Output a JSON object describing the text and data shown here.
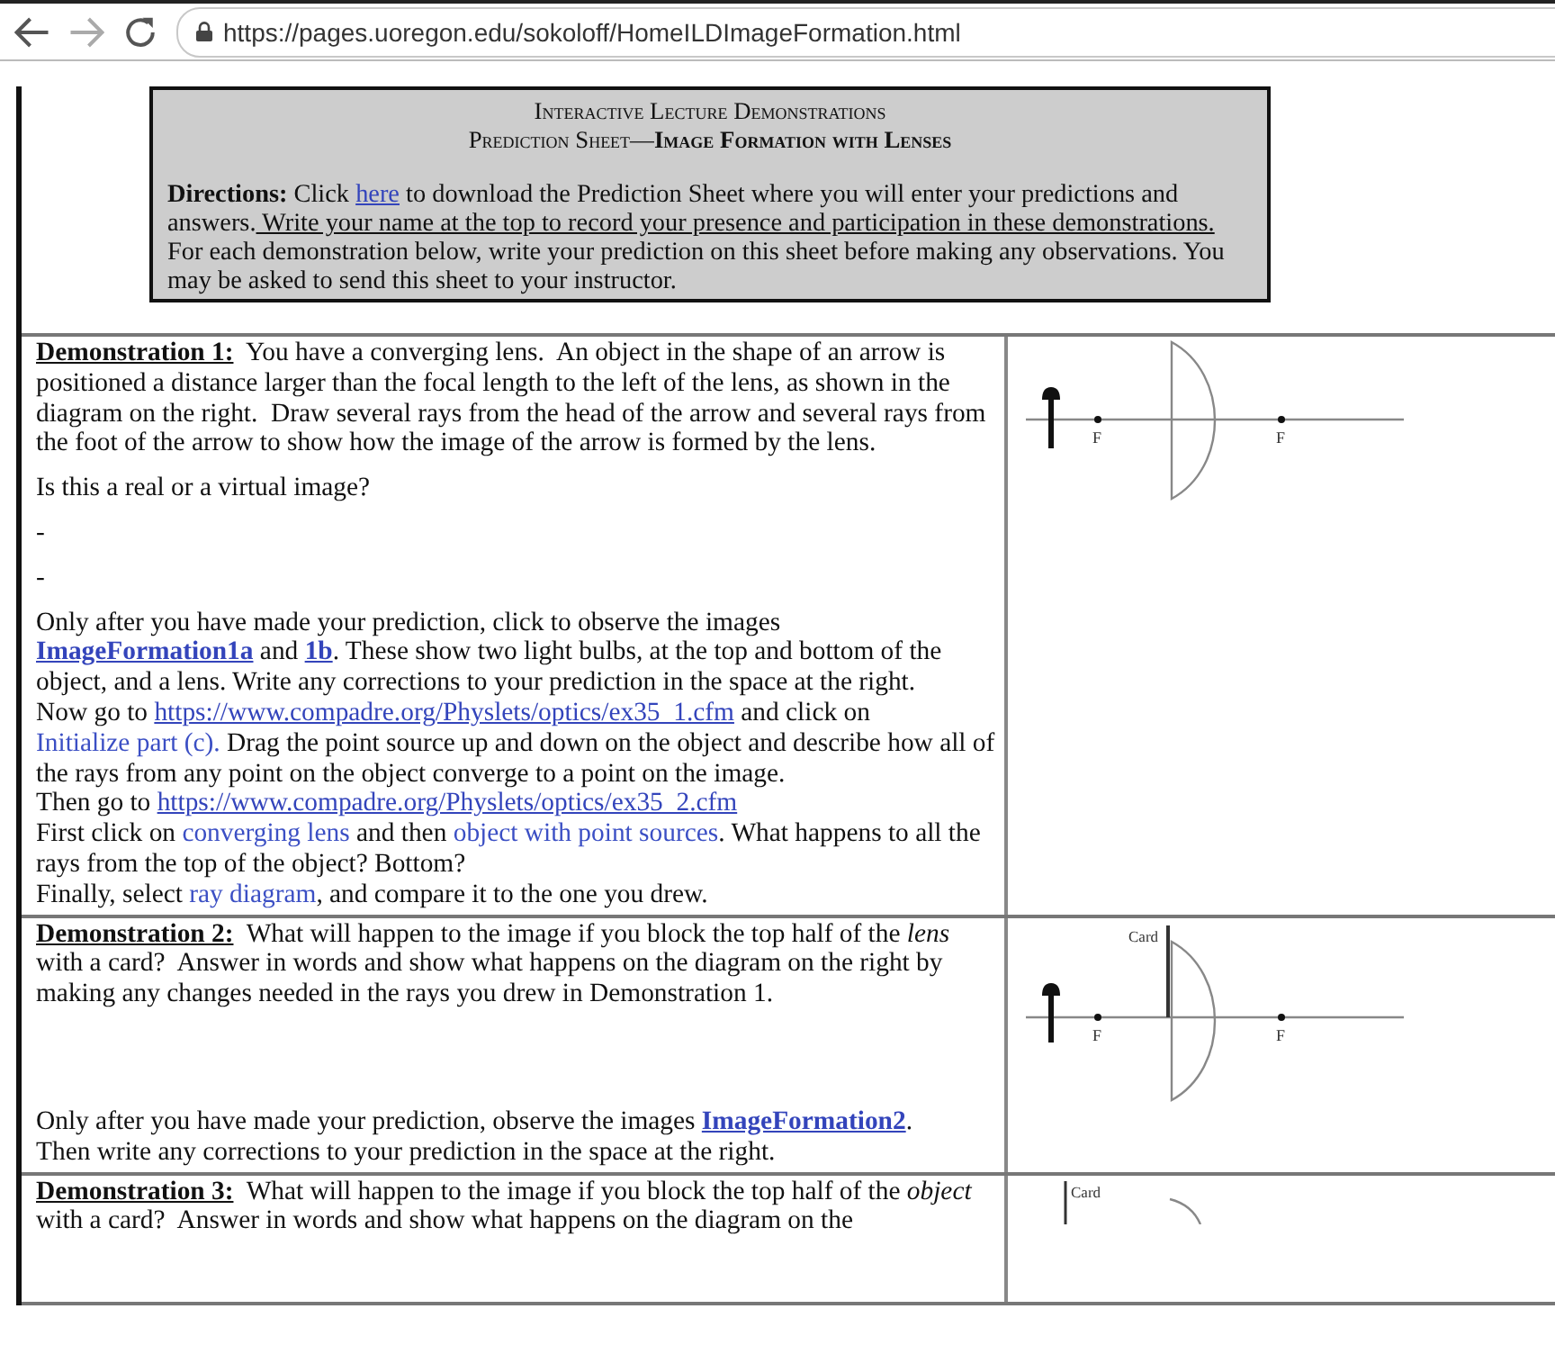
{
  "browser": {
    "url": "https://pages.uoregon.edu/sokoloff/HomeILDImageFormation.html"
  },
  "header": {
    "title": "Interactive Lecture Demonstrations",
    "subtitle": "Prediction Sheet—**Image Formation with Lenses**",
    "directions": [
      {
        "kind": "bold",
        "text": "Directions:"
      },
      {
        "kind": "text",
        "text": " Click "
      },
      {
        "kind": "link",
        "text": "here"
      },
      {
        "kind": "text",
        "text": " to download the Prediction Sheet where you will enter your predictions and answers."
      },
      {
        "kind": "underline",
        "text": " Write your name at the top to record your presence and participation in these demonstrations."
      },
      {
        "kind": "text",
        "text": " For each demonstration below, write your prediction on this sheet before making any observations. You may be asked to send this sheet to your instructor."
      }
    ]
  },
  "demonstrations": [
    {
      "blocks": [
        {
          "kind": "para",
          "segments": [
            {
              "kind": "bold-underline",
              "text": "Demonstration 1:"
            },
            {
              "kind": "text",
              "text": "  You have a converging lens.  An object in the shape of an arrow is positioned a distance larger than the focal length to the left of the lens, as shown in the diagram on the right.  Draw several rays from the head of the arrow and several rays from the foot of the arrow to show how the image of the arrow is formed by the lens."
            }
          ]
        },
        {
          "kind": "para",
          "segments": [
            {
              "kind": "text",
              "text": "Is this a real or a virtual image?"
            }
          ]
        },
        {
          "kind": "para",
          "segments": [
            {
              "kind": "text",
              "text": "-"
            }
          ]
        },
        {
          "kind": "para",
          "segments": [
            {
              "kind": "text",
              "text": "-"
            }
          ]
        },
        {
          "kind": "line",
          "segments": [
            {
              "kind": "text",
              "text": "Only after you have made your prediction, click to observe the images "
            },
            {
              "kind": "link-bold",
              "text": "ImageFormation1a"
            },
            {
              "kind": "text",
              "text": " and "
            },
            {
              "kind": "link-bold",
              "text": "1b"
            },
            {
              "kind": "text",
              "text": ". These show two light bulbs, at the top and bottom of the object, and a lens. Write any corrections to your prediction in the space at the right."
            }
          ]
        },
        {
          "kind": "line",
          "segments": [
            {
              "kind": "text",
              "text": "Now go to "
            },
            {
              "kind": "link",
              "text": "https://www.compadre.org/Physlets/optics/ex35_1.cfm"
            },
            {
              "kind": "text",
              "text": " and click on "
            },
            {
              "kind": "link-plain",
              "text": "Initialize part (c)."
            },
            {
              "kind": "text",
              "text": " Drag the point source up and down on the object and describe how all of the rays from any point on the object converge to a point on the image."
            }
          ]
        },
        {
          "kind": "line",
          "segments": [
            {
              "kind": "text",
              "text": "Then go to "
            },
            {
              "kind": "link",
              "text": "https://www.compadre.org/Physlets/optics/ex35_2.cfm"
            }
          ]
        },
        {
          "kind": "line",
          "segments": [
            {
              "kind": "text",
              "text": "First click on "
            },
            {
              "kind": "link-plain",
              "text": "converging lens"
            },
            {
              "kind": "text",
              "text": " and then "
            },
            {
              "kind": "link-plain",
              "text": "object with point sources"
            },
            {
              "kind": "text",
              "text": ". What happens to all the rays from the top of the object? Bottom?"
            }
          ]
        },
        {
          "kind": "line",
          "segments": [
            {
              "kind": "text",
              "text": "Finally, select "
            },
            {
              "kind": "link-plain",
              "text": "ray diagram"
            },
            {
              "kind": "text",
              "text": ", and compare it to the one you drew."
            }
          ]
        }
      ],
      "diagram": {
        "kind": "plain",
        "focal_labels": [
          "F",
          "F"
        ]
      }
    },
    {
      "blocks": [
        {
          "kind": "para",
          "segments": [
            {
              "kind": "bold-underline",
              "text": "Demonstration 2:"
            },
            {
              "kind": "text",
              "text": "  What will happen to the image if you block the top half of the "
            },
            {
              "kind": "italic",
              "text": "lens"
            },
            {
              "kind": "text",
              "text": " with a card?  Answer in words and show what happens on the diagram on the right by making any changes needed in the rays you drew in Demonstration 1."
            }
          ]
        },
        {
          "kind": "spacer"
        },
        {
          "kind": "line",
          "segments": [
            {
              "kind": "text",
              "text": "Only after you have made your prediction, observe the images "
            },
            {
              "kind": "link-bold",
              "text": "ImageFormation2"
            },
            {
              "kind": "text",
              "text": "."
            }
          ]
        },
        {
          "kind": "line",
          "segments": [
            {
              "kind": "text",
              "text": "Then write any corrections to your prediction in the space at the right."
            }
          ]
        }
      ],
      "diagram": {
        "kind": "card-lens",
        "card_label": "Card",
        "focal_labels": [
          "F",
          "F"
        ]
      }
    },
    {
      "blocks": [
        {
          "kind": "para",
          "segments": [
            {
              "kind": "bold-underline",
              "text": "Demonstration 3:"
            },
            {
              "kind": "text",
              "text": "  What will happen to the image if you block the top half of the "
            },
            {
              "kind": "italic",
              "text": "object"
            },
            {
              "kind": "text",
              "text": " with a card?  Answer in words and show what happens on the diagram on the"
            }
          ]
        }
      ],
      "diagram": {
        "kind": "card-object",
        "card_label": "Card"
      }
    }
  ]
}
